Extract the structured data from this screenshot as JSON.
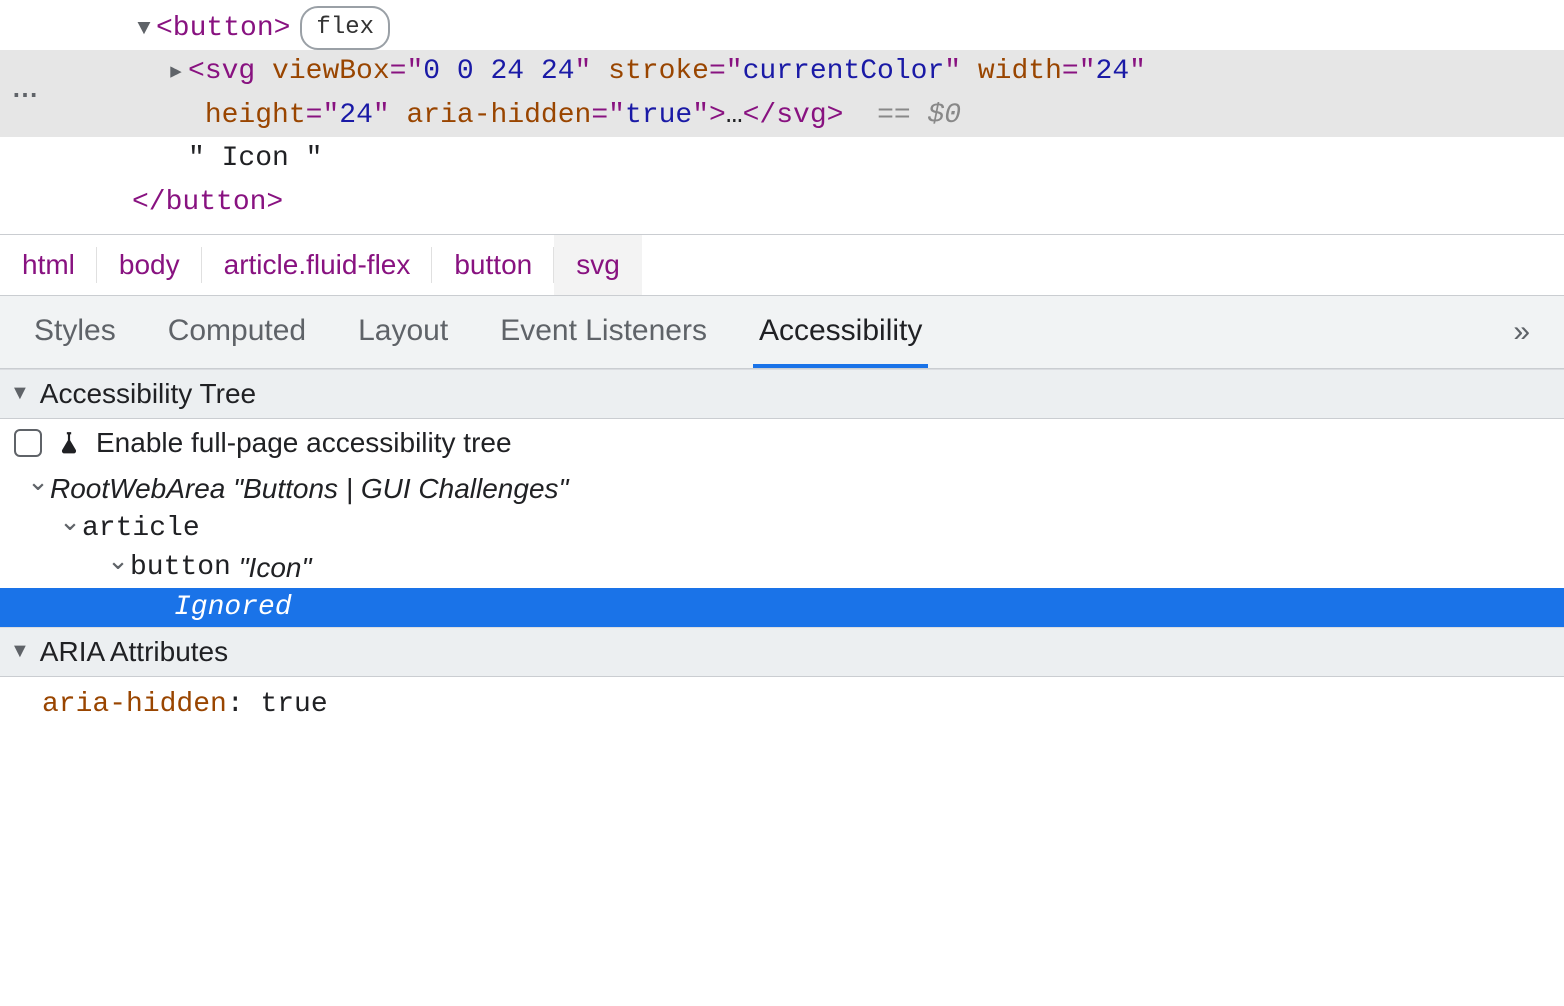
{
  "elements": {
    "button_open": "<button>",
    "button_close": "</button>",
    "flex_badge": "flex",
    "svg_open_tag": "svg",
    "svg_attrs": [
      {
        "name": "viewBox",
        "value": "0 0 24 24"
      },
      {
        "name": "stroke",
        "value": "currentColor"
      },
      {
        "name": "width",
        "value": "24"
      },
      {
        "name": "height",
        "value": "24"
      },
      {
        "name": "aria-hidden",
        "value": "true"
      }
    ],
    "svg_ellipsis": "…",
    "svg_close": "</svg>",
    "eq_dollar": "== $0",
    "icon_text": "\" Icon \""
  },
  "breadcrumb": [
    "html",
    "body",
    "article.fluid-flex",
    "button",
    "svg"
  ],
  "tabs": {
    "items": [
      "Styles",
      "Computed",
      "Layout",
      "Event Listeners",
      "Accessibility"
    ],
    "active_index": 4,
    "overflow_glyph": "»"
  },
  "a11y": {
    "tree_section_title": "Accessibility Tree",
    "enable_full_label": "Enable full-page accessibility tree",
    "tree": {
      "root_role": "RootWebArea",
      "root_name": "\"Buttons | GUI Challenges\"",
      "article_role": "article",
      "button_role": "button",
      "button_name": "\"Icon\"",
      "ignored_label": "Ignored"
    },
    "aria_section_title": "ARIA Attributes",
    "aria_attr_name": "aria-hidden",
    "aria_attr_value": "true"
  }
}
